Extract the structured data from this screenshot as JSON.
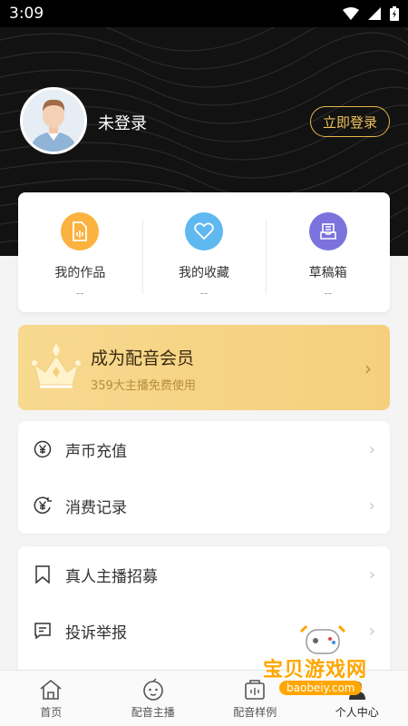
{
  "status_bar": {
    "time": "3:09"
  },
  "profile": {
    "username": "未登录",
    "login_label": "立即登录"
  },
  "stats": [
    {
      "label": "我的作品",
      "value": "--",
      "icon": "audio-file-icon",
      "color": "#fbb23f"
    },
    {
      "label": "我的收藏",
      "value": "--",
      "icon": "heart-icon",
      "color": "#5fb8ef"
    },
    {
      "label": "草稿箱",
      "value": "--",
      "icon": "inbox-icon",
      "color": "#7c72dd"
    }
  ],
  "vip": {
    "title": "成为配音会员",
    "subtitle": "359大主播免费使用",
    "icon": "crown-icon"
  },
  "menu_group1": [
    {
      "label": "声币充值",
      "icon": "yen-circle-icon"
    },
    {
      "label": "消费记录",
      "icon": "yen-history-icon"
    }
  ],
  "menu_group2": [
    {
      "label": "真人主播招募",
      "icon": "bookmark-icon"
    },
    {
      "label": "投诉举报",
      "icon": "report-message-icon"
    }
  ],
  "tabs": [
    {
      "label": "首页",
      "icon": "home-icon"
    },
    {
      "label": "配音主播",
      "icon": "anchor-face-icon"
    },
    {
      "label": "配音样例",
      "icon": "sample-box-icon"
    },
    {
      "label": "个人中心",
      "icon": "person-icon"
    }
  ],
  "watermark": {
    "text": "宝贝游戏网",
    "url": "baobeiy.com"
  },
  "colors": {
    "accent_gold": "#e8b648",
    "header_bg": "#121212",
    "vip_bg": "#f7d98f"
  }
}
